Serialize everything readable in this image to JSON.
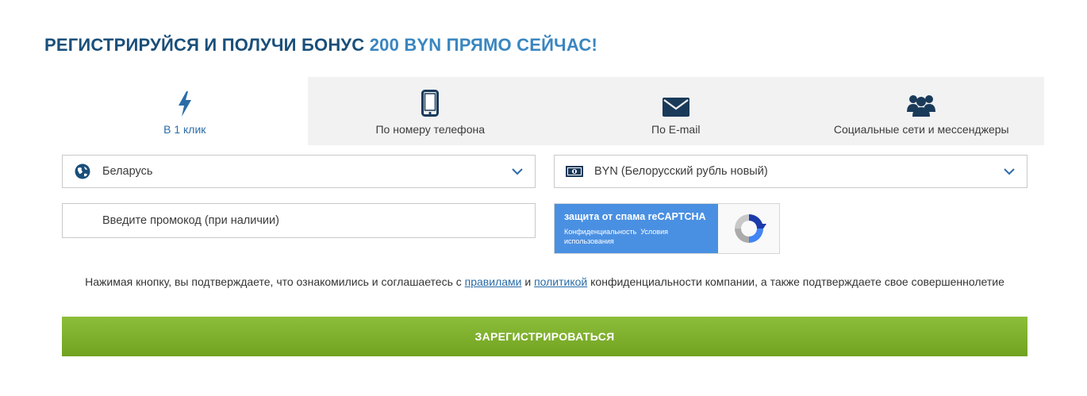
{
  "header": {
    "title_part1": "РЕГИСТРИРУЙСЯ И ПОЛУЧИ БОНУС ",
    "title_part2": "200 BYN ПРЯМО СЕЙЧАС!"
  },
  "tabs": [
    {
      "label": "В 1 клик",
      "icon": "lightning-icon",
      "active": true
    },
    {
      "label": "По номеру телефона",
      "icon": "phone-icon",
      "active": false
    },
    {
      "label": "По E-mail",
      "icon": "envelope-icon",
      "active": false
    },
    {
      "label": "Социальные сети и мессенджеры",
      "icon": "users-icon",
      "active": false
    }
  ],
  "form": {
    "country": {
      "value": "Беларусь",
      "icon": "globe-icon"
    },
    "currency": {
      "value": "BYN (Белорусский рубль новый)",
      "icon": "banknote-icon"
    },
    "promo": {
      "placeholder": "Введите промокод (при наличии)"
    }
  },
  "recaptcha": {
    "title": "защита от спама reCAPTCHA",
    "privacy": "Конфиденциальность",
    "terms": "Условия использования"
  },
  "terms": {
    "text_before": "Нажимая кнопку, вы подтверждаете, что ознакомились и соглашаетесь с ",
    "rules_link": "правилами",
    "and": " и ",
    "policy_link": "политикой",
    "text_after": " конфиденциальности компании, а также подтверждаете свое совершеннолетие"
  },
  "submit": {
    "label": "ЗАРЕГИСТРИРОВАТЬСЯ"
  },
  "colors": {
    "title_dark": "#1a4f7a",
    "title_accent": "#3a86c0",
    "link": "#2a6ca8",
    "button_green": "#7fb02c",
    "recaptcha_blue": "#4a90e2"
  }
}
